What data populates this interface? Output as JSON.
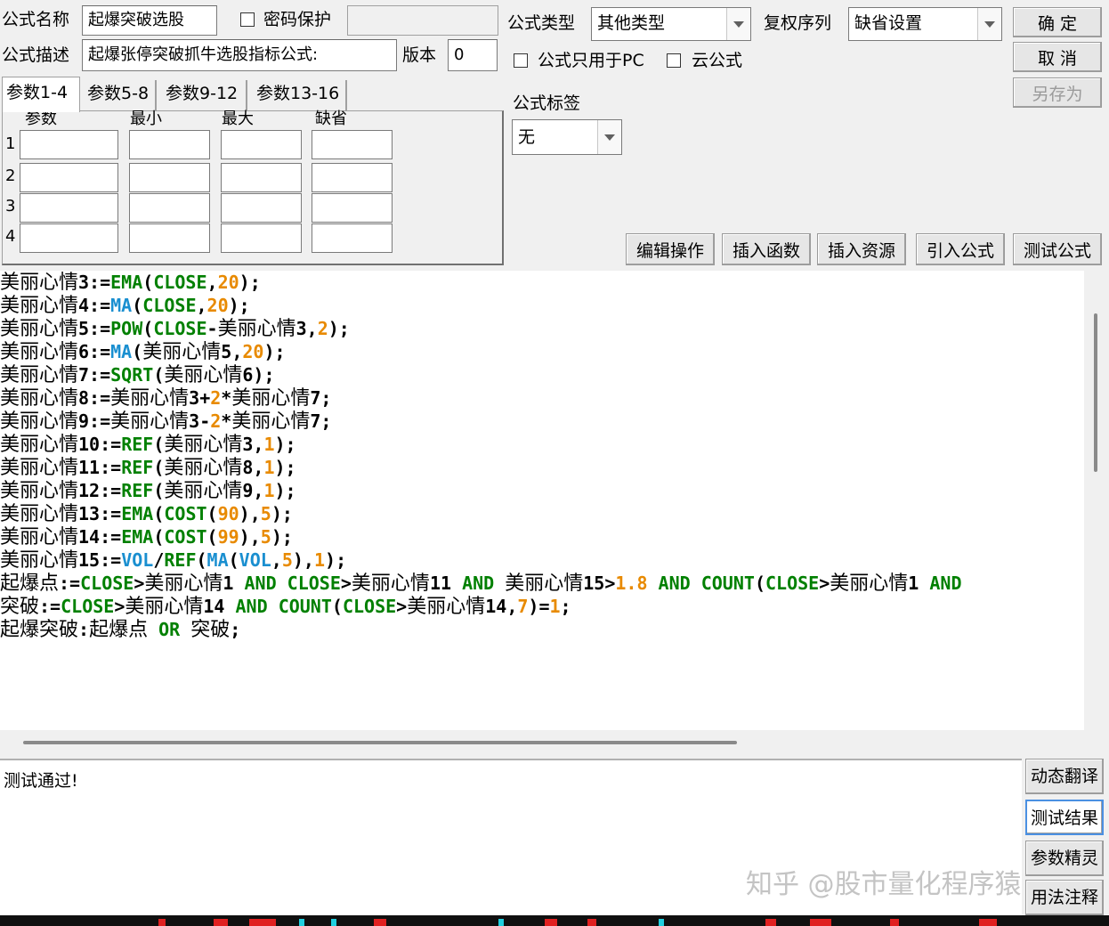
{
  "header": {
    "name_label": "公式名称",
    "name_value": "起爆突破选股",
    "password_label": "密码保护",
    "password_value": "",
    "desc_label": "公式描述",
    "desc_value": "起爆张停突破抓牛选股指标公式:",
    "version_label": "版本",
    "version_value": "0",
    "type_label": "公式类型",
    "type_value": "其他类型",
    "fuquan_label": "复权序列",
    "fuquan_value": "缺省设置",
    "pc_only_label": "公式只用于PC",
    "cloud_label": "云公式",
    "tag_label": "公式标签",
    "tag_value": "无"
  },
  "buttons": {
    "ok": "确 定",
    "cancel": "取 消",
    "save_as": "另存为",
    "edit_ops": "编辑操作",
    "insert_func": "插入函数",
    "insert_res": "插入资源",
    "import_formula": "引入公式",
    "test_formula": "测试公式"
  },
  "tabs": [
    "参数1-4",
    "参数5-8",
    "参数9-12",
    "参数13-16"
  ],
  "params": {
    "headers": [
      "参数",
      "最小",
      "最大",
      "缺省"
    ],
    "rows": [
      "1",
      "2",
      "3",
      "4"
    ]
  },
  "code_lines": [
    [
      [
        "b",
        "美丽心情"
      ],
      [
        "k",
        "3:="
      ],
      [
        "g",
        "EMA"
      ],
      [
        "k",
        "("
      ],
      [
        "g",
        "CLOSE"
      ],
      [
        "k",
        ","
      ],
      [
        "n",
        "20"
      ],
      [
        "k",
        ");"
      ]
    ],
    [
      [
        "b",
        "美丽心情"
      ],
      [
        "k",
        "4:="
      ],
      [
        "c",
        "MA"
      ],
      [
        "k",
        "("
      ],
      [
        "g",
        "CLOSE"
      ],
      [
        "k",
        ","
      ],
      [
        "n",
        "20"
      ],
      [
        "k",
        ");"
      ]
    ],
    [
      [
        "b",
        "美丽心情"
      ],
      [
        "k",
        "5:="
      ],
      [
        "g",
        "POW"
      ],
      [
        "k",
        "("
      ],
      [
        "g",
        "CLOSE"
      ],
      [
        "k",
        "-"
      ],
      [
        "b",
        "美丽心情"
      ],
      [
        "k",
        "3,"
      ],
      [
        "n",
        "2"
      ],
      [
        "k",
        ");"
      ]
    ],
    [
      [
        "b",
        "美丽心情"
      ],
      [
        "k",
        "6:="
      ],
      [
        "c",
        "MA"
      ],
      [
        "k",
        "("
      ],
      [
        "b",
        "美丽心情"
      ],
      [
        "k",
        "5,"
      ],
      [
        "n",
        "20"
      ],
      [
        "k",
        ");"
      ]
    ],
    [
      [
        "b",
        "美丽心情"
      ],
      [
        "k",
        "7:="
      ],
      [
        "g",
        "SQRT"
      ],
      [
        "k",
        "("
      ],
      [
        "b",
        "美丽心情"
      ],
      [
        "k",
        "6);"
      ]
    ],
    [
      [
        "b",
        "美丽心情"
      ],
      [
        "k",
        "8:="
      ],
      [
        "b",
        "美丽心情"
      ],
      [
        "k",
        "3+"
      ],
      [
        "n",
        "2"
      ],
      [
        "k",
        "*"
      ],
      [
        "b",
        "美丽心情"
      ],
      [
        "k",
        "7;"
      ]
    ],
    [
      [
        "b",
        "美丽心情"
      ],
      [
        "k",
        "9:="
      ],
      [
        "b",
        "美丽心情"
      ],
      [
        "k",
        "3-"
      ],
      [
        "n",
        "2"
      ],
      [
        "k",
        "*"
      ],
      [
        "b",
        "美丽心情"
      ],
      [
        "k",
        "7;"
      ]
    ],
    [
      [
        "b",
        "美丽心情"
      ],
      [
        "k",
        "10:="
      ],
      [
        "g",
        "REF"
      ],
      [
        "k",
        "("
      ],
      [
        "b",
        "美丽心情"
      ],
      [
        "k",
        "3,"
      ],
      [
        "n",
        "1"
      ],
      [
        "k",
        ");"
      ]
    ],
    [
      [
        "b",
        "美丽心情"
      ],
      [
        "k",
        "11:="
      ],
      [
        "g",
        "REF"
      ],
      [
        "k",
        "("
      ],
      [
        "b",
        "美丽心情"
      ],
      [
        "k",
        "8,"
      ],
      [
        "n",
        "1"
      ],
      [
        "k",
        ");"
      ]
    ],
    [
      [
        "b",
        "美丽心情"
      ],
      [
        "k",
        "12:="
      ],
      [
        "g",
        "REF"
      ],
      [
        "k",
        "("
      ],
      [
        "b",
        "美丽心情"
      ],
      [
        "k",
        "9,"
      ],
      [
        "n",
        "1"
      ],
      [
        "k",
        ");"
      ]
    ],
    [
      [
        "b",
        "美丽心情"
      ],
      [
        "k",
        "13:="
      ],
      [
        "g",
        "EMA"
      ],
      [
        "k",
        "("
      ],
      [
        "g",
        "COST"
      ],
      [
        "k",
        "("
      ],
      [
        "n",
        "90"
      ],
      [
        "k",
        "),"
      ],
      [
        "n",
        "5"
      ],
      [
        "k",
        ");"
      ]
    ],
    [
      [
        "b",
        "美丽心情"
      ],
      [
        "k",
        "14:="
      ],
      [
        "g",
        "EMA"
      ],
      [
        "k",
        "("
      ],
      [
        "g",
        "COST"
      ],
      [
        "k",
        "("
      ],
      [
        "n",
        "99"
      ],
      [
        "k",
        "),"
      ],
      [
        "n",
        "5"
      ],
      [
        "k",
        ");"
      ]
    ],
    [
      [
        "b",
        "美丽心情"
      ],
      [
        "k",
        "15:="
      ],
      [
        "c",
        "VOL"
      ],
      [
        "k",
        "/"
      ],
      [
        "g",
        "REF"
      ],
      [
        "k",
        "("
      ],
      [
        "c",
        "MA"
      ],
      [
        "k",
        "("
      ],
      [
        "c",
        "VOL"
      ],
      [
        "k",
        ","
      ],
      [
        "n",
        "5"
      ],
      [
        "k",
        "),"
      ],
      [
        "n",
        "1"
      ],
      [
        "k",
        ");"
      ]
    ],
    [
      [
        "b",
        "起爆点"
      ],
      [
        "k",
        ":="
      ],
      [
        "g",
        "CLOSE"
      ],
      [
        "k",
        ">"
      ],
      [
        "b",
        "美丽心情"
      ],
      [
        "k",
        "1 "
      ],
      [
        "g",
        "AND"
      ],
      [
        "k",
        " "
      ],
      [
        "g",
        "CLOSE"
      ],
      [
        "k",
        ">"
      ],
      [
        "b",
        "美丽心情"
      ],
      [
        "k",
        "11 "
      ],
      [
        "g",
        "AND"
      ],
      [
        "k",
        " "
      ],
      [
        "b",
        "美丽心情"
      ],
      [
        "k",
        "15>"
      ],
      [
        "n",
        "1.8"
      ],
      [
        "k",
        " "
      ],
      [
        "g",
        "AND"
      ],
      [
        "k",
        " "
      ],
      [
        "g",
        "COUNT"
      ],
      [
        "k",
        "("
      ],
      [
        "g",
        "CLOSE"
      ],
      [
        "k",
        ">"
      ],
      [
        "b",
        "美丽心情"
      ],
      [
        "k",
        "1 "
      ],
      [
        "g",
        "AND"
      ]
    ],
    [
      [
        "b",
        "突破"
      ],
      [
        "k",
        ":="
      ],
      [
        "g",
        "CLOSE"
      ],
      [
        "k",
        ">"
      ],
      [
        "b",
        "美丽心情"
      ],
      [
        "k",
        "14 "
      ],
      [
        "g",
        "AND"
      ],
      [
        "k",
        " "
      ],
      [
        "g",
        "COUNT"
      ],
      [
        "k",
        "("
      ],
      [
        "g",
        "CLOSE"
      ],
      [
        "k",
        ">"
      ],
      [
        "b",
        "美丽心情"
      ],
      [
        "k",
        "14,"
      ],
      [
        "n",
        "7"
      ],
      [
        "k",
        ")="
      ],
      [
        "n",
        "1"
      ],
      [
        "k",
        ";"
      ]
    ],
    [
      [
        "b",
        "起爆突破"
      ],
      [
        "k",
        ":"
      ],
      [
        "b",
        "起爆点"
      ],
      [
        "k",
        " "
      ],
      [
        "g",
        "OR"
      ],
      [
        "k",
        " "
      ],
      [
        "b",
        "突破"
      ],
      [
        "k",
        ";"
      ]
    ]
  ],
  "message": "测试通过!",
  "side_buttons": [
    "动态翻译",
    "测试结果",
    "参数精灵",
    "用法注释"
  ],
  "watermark": "知乎 @股市量化程序猿",
  "colors": {
    "keyword_green": "#008000",
    "keyword_cyan": "#1a8fd0",
    "number_orange": "#e88a00",
    "selected_border": "#4a90e2"
  }
}
